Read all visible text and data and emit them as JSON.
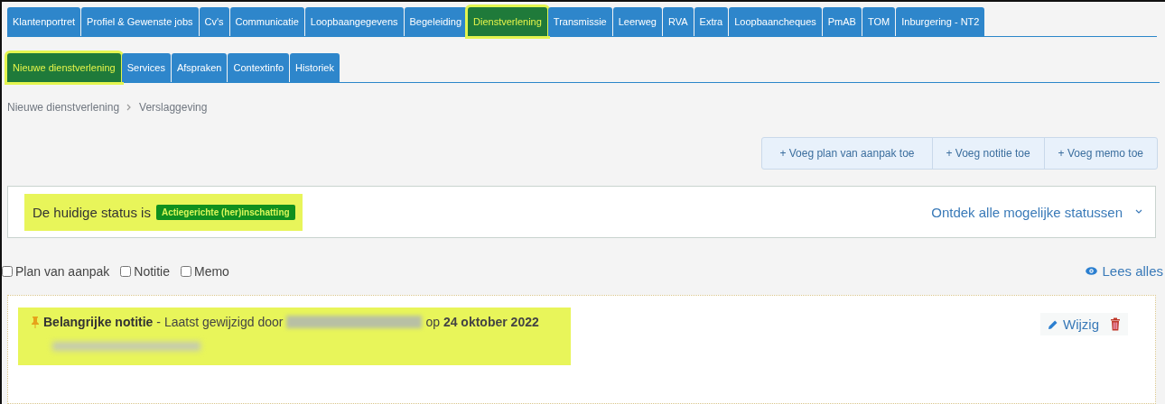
{
  "main_tabs": [
    {
      "label": "Klantenportret",
      "selected": false
    },
    {
      "label": "Profiel & Gewenste jobs",
      "selected": false
    },
    {
      "label": "Cv's",
      "selected": false
    },
    {
      "label": "Communicatie",
      "selected": false
    },
    {
      "label": "Loopbaangegevens",
      "selected": false
    },
    {
      "label": "Begeleiding",
      "selected": false
    },
    {
      "label": "Dienstverlening",
      "selected": true,
      "highlighted": true
    },
    {
      "label": "Transmissie",
      "selected": false
    },
    {
      "label": "Leerweg",
      "selected": false
    },
    {
      "label": "RVA",
      "selected": false
    },
    {
      "label": "Extra",
      "selected": false
    },
    {
      "label": "Loopbaancheques",
      "selected": false
    },
    {
      "label": "PmAB",
      "selected": false
    },
    {
      "label": "TOM",
      "selected": false
    },
    {
      "label": "Inburgering - NT2",
      "selected": false
    }
  ],
  "sub_tabs": [
    {
      "label": "Nieuwe dienstverlening",
      "selected": true,
      "highlighted": true
    },
    {
      "label": "Services",
      "selected": false
    },
    {
      "label": "Afspraken",
      "selected": false
    },
    {
      "label": "Contextinfo",
      "selected": false
    },
    {
      "label": "Historiek",
      "selected": false
    }
  ],
  "breadcrumb": [
    "Nieuwe dienstverlening",
    "Verslaggeving"
  ],
  "add_buttons": [
    "+ Voeg plan van aanpak toe",
    "+ Voeg notitie toe",
    "+ Voeg memo toe"
  ],
  "status": {
    "label": "De huidige status is",
    "badge": "Actiegerichte (her)inschatting",
    "highlighted": true,
    "link": "Ontdek alle mogelijke statussen"
  },
  "filters": [
    {
      "label": "Plan van aanpak",
      "checked": false
    },
    {
      "label": "Notitie",
      "checked": false
    },
    {
      "label": "Memo",
      "checked": false
    }
  ],
  "read_all": "Lees alles",
  "note": {
    "title": "Belangrijke notitie",
    "modified_by": "- Laatst gewijzigd door",
    "date": "op **24 oktober 2022**",
    "highlighted": true,
    "edit": "Wijzig"
  }
}
